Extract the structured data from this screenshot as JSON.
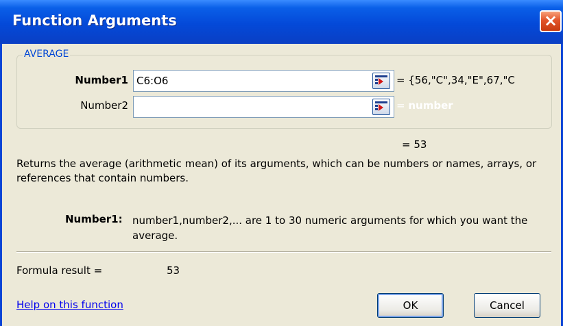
{
  "window": {
    "title": "Function Arguments",
    "close_label": "×"
  },
  "function_group": {
    "name": "AVERAGE",
    "args": [
      {
        "label": "Number1",
        "value": "C6:O6",
        "result": "= {56,\"C\",34,\"E\",67,\"C"
      },
      {
        "label": "Number2",
        "value": "",
        "result_prefix": "=",
        "result_hint": "number"
      }
    ]
  },
  "computed_value": "= 53",
  "description": "Returns the average (arithmetic mean) of its arguments, which can be numbers or names, arrays, or references that contain numbers.",
  "arg_help": {
    "label": "Number1:",
    "text": "number1,number2,... are 1 to 30 numeric arguments for which you want the average."
  },
  "formula_result": {
    "label": "Formula result =",
    "value": "53"
  },
  "help_link": "Help on this function",
  "buttons": {
    "ok": "OK",
    "cancel": "Cancel"
  },
  "colors": {
    "title_bar": "#0449d8",
    "dialog_face": "#ece9d8",
    "group_legend": "#0046d5",
    "link": "#0000ee",
    "close_button": "#e2542a"
  }
}
